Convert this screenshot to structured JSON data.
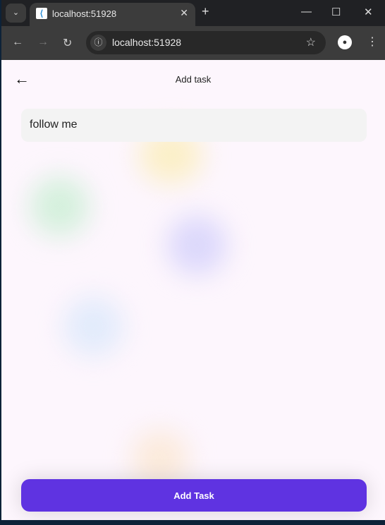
{
  "browser": {
    "tab_title": "localhost:51928",
    "url": "localhost:51928"
  },
  "app": {
    "title": "Add task",
    "task_input_value": "follow me",
    "submit_label": "Add Task",
    "accent": "#5f33e1"
  }
}
